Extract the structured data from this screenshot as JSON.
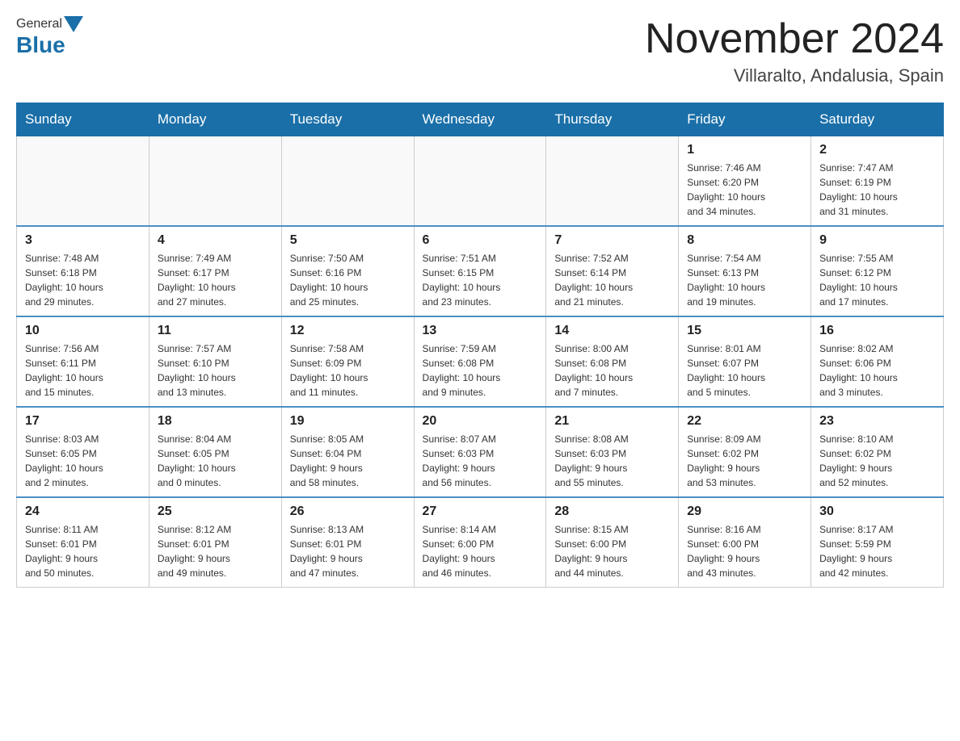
{
  "header": {
    "logo": {
      "text_general": "General",
      "text_blue": "Blue"
    },
    "title": "November 2024",
    "location": "Villaralto, Andalusia, Spain"
  },
  "weekdays": [
    "Sunday",
    "Monday",
    "Tuesday",
    "Wednesday",
    "Thursday",
    "Friday",
    "Saturday"
  ],
  "weeks": [
    [
      {
        "day": "",
        "info": ""
      },
      {
        "day": "",
        "info": ""
      },
      {
        "day": "",
        "info": ""
      },
      {
        "day": "",
        "info": ""
      },
      {
        "day": "",
        "info": ""
      },
      {
        "day": "1",
        "info": "Sunrise: 7:46 AM\nSunset: 6:20 PM\nDaylight: 10 hours\nand 34 minutes."
      },
      {
        "day": "2",
        "info": "Sunrise: 7:47 AM\nSunset: 6:19 PM\nDaylight: 10 hours\nand 31 minutes."
      }
    ],
    [
      {
        "day": "3",
        "info": "Sunrise: 7:48 AM\nSunset: 6:18 PM\nDaylight: 10 hours\nand 29 minutes."
      },
      {
        "day": "4",
        "info": "Sunrise: 7:49 AM\nSunset: 6:17 PM\nDaylight: 10 hours\nand 27 minutes."
      },
      {
        "day": "5",
        "info": "Sunrise: 7:50 AM\nSunset: 6:16 PM\nDaylight: 10 hours\nand 25 minutes."
      },
      {
        "day": "6",
        "info": "Sunrise: 7:51 AM\nSunset: 6:15 PM\nDaylight: 10 hours\nand 23 minutes."
      },
      {
        "day": "7",
        "info": "Sunrise: 7:52 AM\nSunset: 6:14 PM\nDaylight: 10 hours\nand 21 minutes."
      },
      {
        "day": "8",
        "info": "Sunrise: 7:54 AM\nSunset: 6:13 PM\nDaylight: 10 hours\nand 19 minutes."
      },
      {
        "day": "9",
        "info": "Sunrise: 7:55 AM\nSunset: 6:12 PM\nDaylight: 10 hours\nand 17 minutes."
      }
    ],
    [
      {
        "day": "10",
        "info": "Sunrise: 7:56 AM\nSunset: 6:11 PM\nDaylight: 10 hours\nand 15 minutes."
      },
      {
        "day": "11",
        "info": "Sunrise: 7:57 AM\nSunset: 6:10 PM\nDaylight: 10 hours\nand 13 minutes."
      },
      {
        "day": "12",
        "info": "Sunrise: 7:58 AM\nSunset: 6:09 PM\nDaylight: 10 hours\nand 11 minutes."
      },
      {
        "day": "13",
        "info": "Sunrise: 7:59 AM\nSunset: 6:08 PM\nDaylight: 10 hours\nand 9 minutes."
      },
      {
        "day": "14",
        "info": "Sunrise: 8:00 AM\nSunset: 6:08 PM\nDaylight: 10 hours\nand 7 minutes."
      },
      {
        "day": "15",
        "info": "Sunrise: 8:01 AM\nSunset: 6:07 PM\nDaylight: 10 hours\nand 5 minutes."
      },
      {
        "day": "16",
        "info": "Sunrise: 8:02 AM\nSunset: 6:06 PM\nDaylight: 10 hours\nand 3 minutes."
      }
    ],
    [
      {
        "day": "17",
        "info": "Sunrise: 8:03 AM\nSunset: 6:05 PM\nDaylight: 10 hours\nand 2 minutes."
      },
      {
        "day": "18",
        "info": "Sunrise: 8:04 AM\nSunset: 6:05 PM\nDaylight: 10 hours\nand 0 minutes."
      },
      {
        "day": "19",
        "info": "Sunrise: 8:05 AM\nSunset: 6:04 PM\nDaylight: 9 hours\nand 58 minutes."
      },
      {
        "day": "20",
        "info": "Sunrise: 8:07 AM\nSunset: 6:03 PM\nDaylight: 9 hours\nand 56 minutes."
      },
      {
        "day": "21",
        "info": "Sunrise: 8:08 AM\nSunset: 6:03 PM\nDaylight: 9 hours\nand 55 minutes."
      },
      {
        "day": "22",
        "info": "Sunrise: 8:09 AM\nSunset: 6:02 PM\nDaylight: 9 hours\nand 53 minutes."
      },
      {
        "day": "23",
        "info": "Sunrise: 8:10 AM\nSunset: 6:02 PM\nDaylight: 9 hours\nand 52 minutes."
      }
    ],
    [
      {
        "day": "24",
        "info": "Sunrise: 8:11 AM\nSunset: 6:01 PM\nDaylight: 9 hours\nand 50 minutes."
      },
      {
        "day": "25",
        "info": "Sunrise: 8:12 AM\nSunset: 6:01 PM\nDaylight: 9 hours\nand 49 minutes."
      },
      {
        "day": "26",
        "info": "Sunrise: 8:13 AM\nSunset: 6:01 PM\nDaylight: 9 hours\nand 47 minutes."
      },
      {
        "day": "27",
        "info": "Sunrise: 8:14 AM\nSunset: 6:00 PM\nDaylight: 9 hours\nand 46 minutes."
      },
      {
        "day": "28",
        "info": "Sunrise: 8:15 AM\nSunset: 6:00 PM\nDaylight: 9 hours\nand 44 minutes."
      },
      {
        "day": "29",
        "info": "Sunrise: 8:16 AM\nSunset: 6:00 PM\nDaylight: 9 hours\nand 43 minutes."
      },
      {
        "day": "30",
        "info": "Sunrise: 8:17 AM\nSunset: 5:59 PM\nDaylight: 9 hours\nand 42 minutes."
      }
    ]
  ]
}
